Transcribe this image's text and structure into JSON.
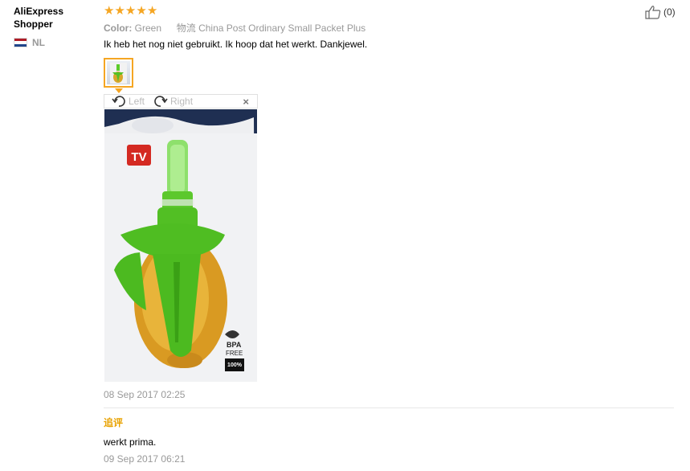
{
  "user": {
    "name": "AliExpress Shopper",
    "country_code": "NL"
  },
  "review": {
    "stars": 5,
    "helpful_count": "(0)",
    "color_label": "Color:",
    "color_value": "Green",
    "logistics_label": "物流",
    "logistics_value": "China Post Ordinary Small Packet Plus",
    "text": "Ik heb het nog niet gebruikt. Ik hoop dat het werkt. Dankjewel.",
    "date": "08 Sep 2017 02:25"
  },
  "viewer": {
    "rotate_left": "Left",
    "rotate_right": "Right",
    "close": "×"
  },
  "followup": {
    "label": "追评",
    "text": "werkt prima.",
    "date": "09 Sep 2017 06:21"
  },
  "colors": {
    "star": "#f5a623",
    "followup_label": "#e8a200",
    "thumb_border": "#f5a623"
  }
}
